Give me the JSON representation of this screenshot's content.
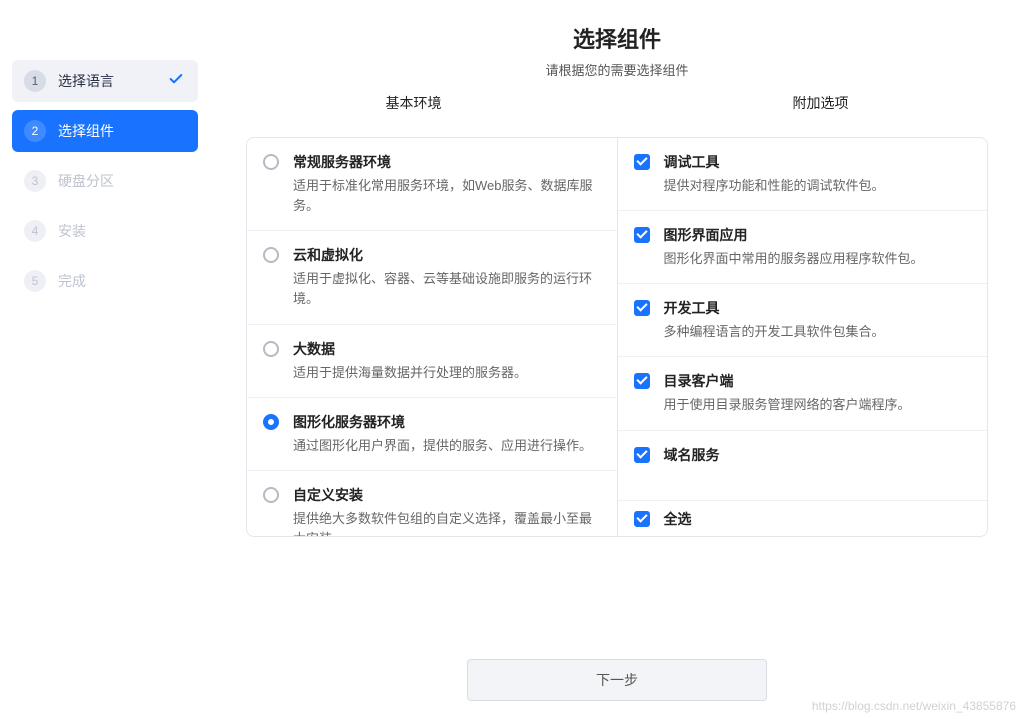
{
  "sidebar": {
    "steps": [
      {
        "num": "1",
        "label": "选择语言",
        "state": "done"
      },
      {
        "num": "2",
        "label": "选择组件",
        "state": "active"
      },
      {
        "num": "3",
        "label": "硬盘分区",
        "state": "pending"
      },
      {
        "num": "4",
        "label": "安装",
        "state": "pending"
      },
      {
        "num": "5",
        "label": "完成",
        "state": "pending"
      }
    ]
  },
  "header": {
    "title": "选择组件",
    "subtitle": "请根据您的需要选择组件",
    "col_left": "基本环境",
    "col_right": "附加选项"
  },
  "basic_env": [
    {
      "id": "std-server",
      "title": "常规服务器环境",
      "desc": "适用于标准化常用服务环境，如Web服务、数据库服务。",
      "selected": false
    },
    {
      "id": "cloud-virt",
      "title": "云和虚拟化",
      "desc": "适用于虚拟化、容器、云等基础设施即服务的运行环境。",
      "selected": false
    },
    {
      "id": "bigdata",
      "title": "大数据",
      "desc": "适用于提供海量数据并行处理的服务器。",
      "selected": false
    },
    {
      "id": "gui-server",
      "title": "图形化服务器环境",
      "desc": "通过图形化用户界面，提供的服务、应用进行操作。",
      "selected": true
    },
    {
      "id": "custom",
      "title": "自定义安装",
      "desc": "提供绝大多数软件包组的自定义选择，覆盖最小至最大安装。",
      "selected": false
    }
  ],
  "addons": [
    {
      "id": "debug",
      "title": "调试工具",
      "desc": "提供对程序功能和性能的调试软件包。",
      "selected": true
    },
    {
      "id": "gui-app",
      "title": "图形界面应用",
      "desc": "图形化界面中常用的服务器应用程序软件包。",
      "selected": true
    },
    {
      "id": "devtools",
      "title": "开发工具",
      "desc": "多种编程语言的开发工具软件包集合。",
      "selected": true
    },
    {
      "id": "dir-client",
      "title": "目录客户端",
      "desc": "用于使用目录服务管理网络的客户端程序。",
      "selected": true
    },
    {
      "id": "dns",
      "title": "域名服务",
      "desc": "",
      "selected": true
    }
  ],
  "select_all": {
    "label": "全选",
    "checked": true
  },
  "footer": {
    "next": "下一步"
  },
  "watermark": "https://blog.csdn.net/weixin_43855876"
}
